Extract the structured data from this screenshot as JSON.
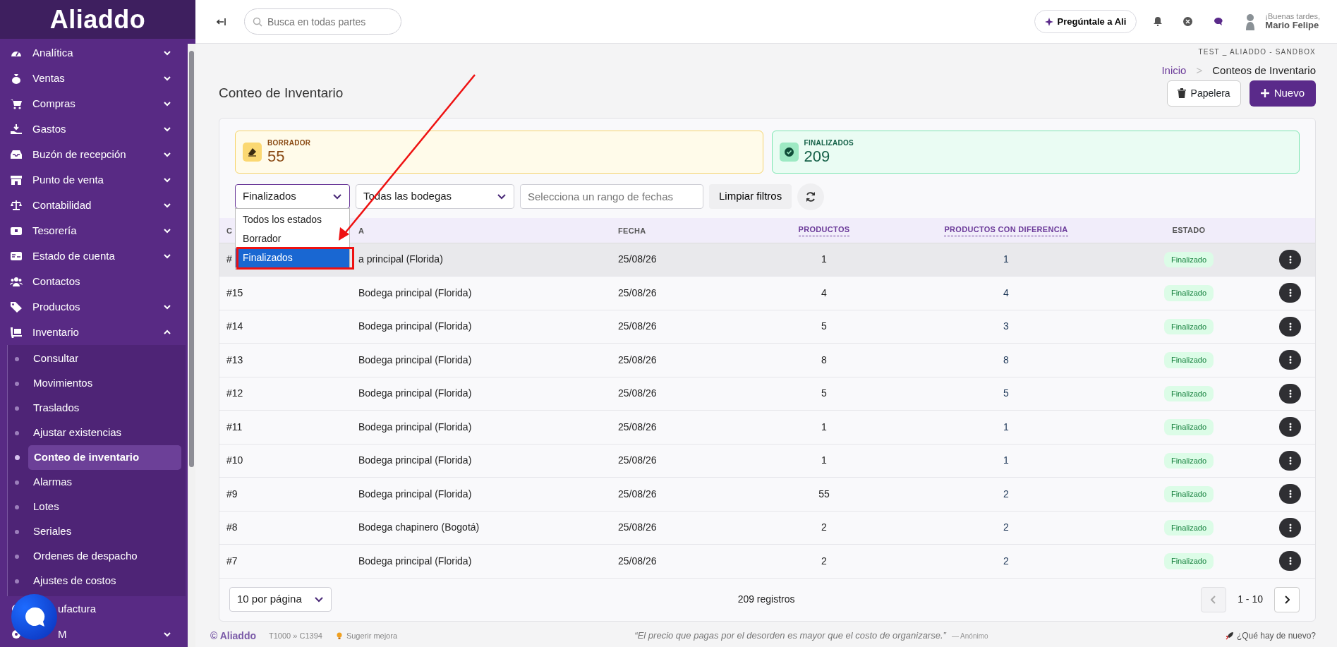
{
  "sidebar": {
    "logo": "Aliaddo",
    "items": [
      {
        "label": "Analítica",
        "expandable": true,
        "expanded": false
      },
      {
        "label": "Ventas",
        "expandable": true,
        "expanded": false
      },
      {
        "label": "Compras",
        "expandable": true,
        "expanded": false
      },
      {
        "label": "Gastos",
        "expandable": true,
        "expanded": false
      },
      {
        "label": "Buzón de recepción",
        "expandable": true,
        "expanded": false
      },
      {
        "label": "Punto de venta",
        "expandable": true,
        "expanded": false
      },
      {
        "label": "Contabilidad",
        "expandable": true,
        "expanded": false
      },
      {
        "label": "Tesorería",
        "expandable": true,
        "expanded": false
      },
      {
        "label": "Estado de cuenta",
        "expandable": true,
        "expanded": false
      },
      {
        "label": "Contactos",
        "expandable": false
      },
      {
        "label": "Productos",
        "expandable": true,
        "expanded": false
      },
      {
        "label": "Inventario",
        "expandable": true,
        "expanded": true,
        "children": [
          {
            "label": "Consultar",
            "selected": false
          },
          {
            "label": "Movimientos",
            "selected": false
          },
          {
            "label": "Traslados",
            "selected": false
          },
          {
            "label": "Ajustar existencias",
            "selected": false
          },
          {
            "label": "Conteo de inventario",
            "selected": true
          },
          {
            "label": "Alarmas",
            "selected": false
          },
          {
            "label": "Lotes",
            "selected": false
          },
          {
            "label": "Seriales",
            "selected": false
          },
          {
            "label": "Ordenes de despacho",
            "selected": false
          },
          {
            "label": "Ajustes de costos",
            "selected": false
          }
        ]
      },
      {
        "label": "ufactura",
        "expandable": false
      },
      {
        "label": "M",
        "expandable": true,
        "expanded": false
      }
    ]
  },
  "header": {
    "search": {
      "placeholder": "Busca en todas partes"
    },
    "ask_button": "Pregúntale a Ali",
    "greeting": "¡Buenas tardes,",
    "user_name": "Mario Felipe"
  },
  "environment": "TEST _ ALIADDO - SANDBOX",
  "breadcrumb": [
    {
      "label": "Inicio",
      "link": true
    },
    {
      "label": ">",
      "link": false
    },
    {
      "label": "Conteos de Inventario",
      "link": false
    }
  ],
  "page_title": "Conteo de Inventario",
  "actions": [
    "Papelera",
    "Nuevo"
  ],
  "stats": [
    {
      "label": "BORRADOR",
      "value": "55",
      "kind": "draft"
    },
    {
      "label": "FINALIZADOS",
      "value": "209",
      "kind": "done"
    }
  ],
  "filters": {
    "status": {
      "value": "Finalizados",
      "options": [
        {
          "label": "Todos los estados",
          "selected": false
        },
        {
          "label": "Borrador",
          "selected": false
        },
        {
          "label": "Finalizados",
          "selected": true
        }
      ]
    },
    "warehouse": {
      "value": "Todas las bodegas"
    },
    "dates": {
      "placeholder": "Selecciona un rango de fechas"
    },
    "clear_button": "Limpiar filtros"
  },
  "table": {
    "columns": [
      {
        "label": "C",
        "sortable": false
      },
      {
        "label": "A",
        "sortable": false
      },
      {
        "label": "FECHA",
        "sortable": false
      },
      {
        "label": "PRODUCTOS",
        "sortable": true
      },
      {
        "label": "PRODUCTOS CON DIFERENCIA",
        "sortable": true
      },
      {
        "label": "ESTADO",
        "sortable": false
      }
    ],
    "rows": [
      {
        "id": "#",
        "warehouse": "a principal (Florida)",
        "date": "25/08/26",
        "products": "1",
        "with_difference": "1",
        "status": "Finalizado",
        "highlighted": true
      },
      {
        "id": "#15",
        "warehouse": "Bodega principal (Florida)",
        "date": "25/08/26",
        "products": "4",
        "with_difference": "4",
        "status": "Finalizado",
        "highlighted": false
      },
      {
        "id": "#14",
        "warehouse": "Bodega principal (Florida)",
        "date": "25/08/26",
        "products": "5",
        "with_difference": "3",
        "status": "Finalizado",
        "highlighted": false
      },
      {
        "id": "#13",
        "warehouse": "Bodega principal (Florida)",
        "date": "25/08/26",
        "products": "8",
        "with_difference": "8",
        "status": "Finalizado",
        "highlighted": false
      },
      {
        "id": "#12",
        "warehouse": "Bodega principal (Florida)",
        "date": "25/08/26",
        "products": "5",
        "with_difference": "5",
        "status": "Finalizado",
        "highlighted": false
      },
      {
        "id": "#11",
        "warehouse": "Bodega principal (Florida)",
        "date": "25/08/26",
        "products": "1",
        "with_difference": "1",
        "status": "Finalizado",
        "highlighted": false
      },
      {
        "id": "#10",
        "warehouse": "Bodega principal (Florida)",
        "date": "25/08/26",
        "products": "1",
        "with_difference": "1",
        "status": "Finalizado",
        "highlighted": false
      },
      {
        "id": "#9",
        "warehouse": "Bodega principal (Florida)",
        "date": "25/08/26",
        "products": "55",
        "with_difference": "2",
        "status": "Finalizado",
        "highlighted": false
      },
      {
        "id": "#8",
        "warehouse": "Bodega chapinero (Bogotá)",
        "date": "25/08/26",
        "products": "2",
        "with_difference": "2",
        "status": "Finalizado",
        "highlighted": false
      },
      {
        "id": "#7",
        "warehouse": "Bodega principal (Florida)",
        "date": "25/08/26",
        "products": "2",
        "with_difference": "2",
        "status": "Finalizado",
        "highlighted": false
      }
    ]
  },
  "pagination": {
    "per_page": "10 por página",
    "total": "209 registros",
    "range": "1 - 10",
    "prev_disabled": true,
    "next_disabled": false
  },
  "footer": {
    "brand": "© Aliaddo",
    "version": "T1000 » C1394",
    "suggest": "Sugerir mejora",
    "quote": "“El precio que pagas por el desorden es mayor que el costo de organizarse.”",
    "author": "— Anónimo",
    "news": "¿Qué hay de nuevo?"
  }
}
